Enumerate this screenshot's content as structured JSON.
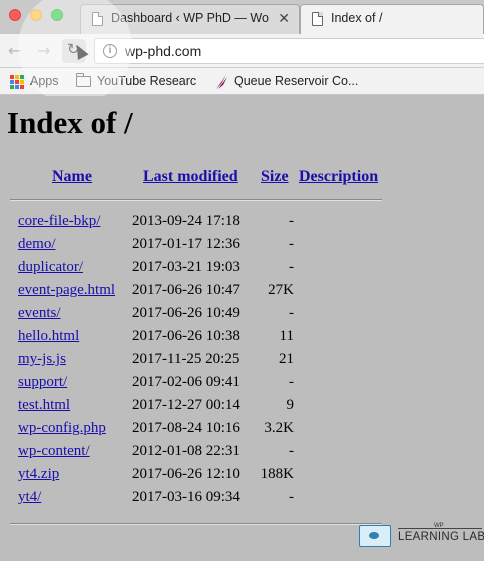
{
  "browser": {
    "tabs": [
      {
        "title": "Dashboard ‹ WP PhD — Wo",
        "close": "✕",
        "active": false
      },
      {
        "title": "Index of /",
        "active": true
      }
    ],
    "url": "wp-phd.com",
    "bookmarks": [
      {
        "label": "Apps",
        "icon": "apps-grid-icon"
      },
      {
        "label": "YouTube Researc",
        "icon": "folder-icon"
      },
      {
        "label": "Queue Reservoir Co...",
        "icon": "quill-icon"
      }
    ],
    "nav": {
      "back": "←",
      "forward": "→",
      "reload": "↻"
    }
  },
  "page": {
    "title": "Index of /",
    "columns": {
      "name": "Name",
      "last_modified": "Last modified",
      "size": "Size",
      "description": "Description"
    },
    "rows": [
      {
        "name": "core-file-bkp/",
        "modified": "2013-09-24 17:18",
        "size": "-"
      },
      {
        "name": "demo/",
        "modified": "2017-01-17 12:36",
        "size": "-"
      },
      {
        "name": "duplicator/",
        "modified": "2017-03-21 19:03",
        "size": "-"
      },
      {
        "name": "event-page.html",
        "modified": "2017-06-26 10:47",
        "size": "27K"
      },
      {
        "name": "events/",
        "modified": "2017-06-26 10:49",
        "size": "-"
      },
      {
        "name": "hello.html",
        "modified": "2017-06-26 10:38",
        "size": "11"
      },
      {
        "name": "my-js.js",
        "modified": "2017-11-25 20:25",
        "size": "21"
      },
      {
        "name": "support/",
        "modified": "2017-02-06 09:41",
        "size": "-"
      },
      {
        "name": "test.html",
        "modified": "2017-12-27 00:14",
        "size": "9"
      },
      {
        "name": "wp-config.php",
        "modified": "2017-08-24 10:16",
        "size": "3.2K"
      },
      {
        "name": "wp-content/",
        "modified": "2012-01-08 22:31",
        "size": "-"
      },
      {
        "name": "yt4.zip",
        "modified": "2017-06-26 12:10",
        "size": "188K"
      },
      {
        "name": "yt4/",
        "modified": "2017-03-16 09:34",
        "size": "-"
      }
    ]
  },
  "watermark": {
    "small": "WP",
    "text": "LEARNING LAB"
  },
  "colors": {
    "link": "#1a0dab",
    "page_bg": "#bdbdbd",
    "chrome_bg": "#f2f2f2"
  }
}
